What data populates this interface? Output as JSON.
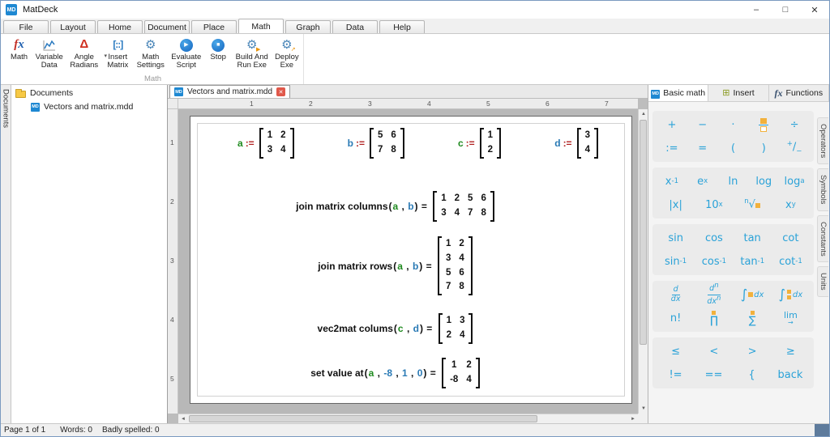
{
  "window": {
    "logo": "MD",
    "title": "MatDeck",
    "controls": [
      {
        "name": "minimize",
        "glyph": "–"
      },
      {
        "name": "maximize",
        "glyph": "□"
      },
      {
        "name": "close",
        "glyph": "✕"
      }
    ]
  },
  "menu_tabs": [
    {
      "label": "File"
    },
    {
      "label": "Layout"
    },
    {
      "label": "Home"
    },
    {
      "label": "Document"
    },
    {
      "label": "Place"
    },
    {
      "label": "Math",
      "active": true
    },
    {
      "label": "Graph"
    },
    {
      "label": "Data"
    },
    {
      "label": "Help"
    }
  ],
  "ribbon": {
    "group_label": "Math",
    "buttons": [
      {
        "label": "Math",
        "icon": "fx"
      },
      {
        "label": "Variable Data",
        "icon": "chart"
      },
      {
        "label": "Angle Radians",
        "icon": "delta",
        "dropdown": true
      },
      {
        "label": "Insert Matrix",
        "icon": "matrix"
      },
      {
        "label": "Math Settings",
        "icon": "gear"
      },
      {
        "label": "Evaluate Script",
        "icon": "play"
      },
      {
        "label": "Stop",
        "icon": "stop"
      },
      {
        "label": "Build And Run Exe",
        "icon": "gear-run"
      },
      {
        "label": "Deploy Exe",
        "icon": "gear-deploy"
      }
    ]
  },
  "left_tab": {
    "label": "Documents"
  },
  "documents_panel": {
    "root_label": "Documents",
    "items": [
      {
        "label": "Vectors and matrix.mdd"
      }
    ]
  },
  "document_tabs": [
    {
      "label": "Vectors and matrix.mdd",
      "active": true
    }
  ],
  "rulers": {
    "horizontal": [
      "1",
      "2",
      "3",
      "4",
      "5",
      "6",
      "7"
    ],
    "vertical": [
      "1",
      "2",
      "3",
      "4",
      "5"
    ]
  },
  "scrollbars": {
    "up": "▲",
    "down": "▼",
    "left": "◄",
    "right": "►"
  },
  "document": {
    "assign_symbol": ":=",
    "syntax": {
      "open": "(",
      "close": ")",
      "comma": " , ",
      "equals": " = "
    },
    "definitions": [
      {
        "name": "a",
        "color": "g",
        "rows": [
          [
            "1",
            "2"
          ],
          [
            "3",
            "4"
          ]
        ]
      },
      {
        "name": "b",
        "color": "b",
        "rows": [
          [
            "5",
            "6"
          ],
          [
            "7",
            "8"
          ]
        ]
      },
      {
        "name": "c",
        "color": "g",
        "rows": [
          [
            "1"
          ],
          [
            "2"
          ]
        ]
      },
      {
        "name": "d",
        "color": "b",
        "rows": [
          [
            "3"
          ],
          [
            "4"
          ]
        ]
      }
    ],
    "expressions": [
      {
        "func": "join matrix columns",
        "args": [
          {
            "t": "a",
            "c": "g"
          },
          {
            "t": "b",
            "c": "b"
          }
        ],
        "result": [
          [
            "1",
            "2",
            "5",
            "6"
          ],
          [
            "3",
            "4",
            "7",
            "8"
          ]
        ]
      },
      {
        "func": "join matrix rows",
        "args": [
          {
            "t": "a",
            "c": "g"
          },
          {
            "t": "b",
            "c": "b"
          }
        ],
        "result": [
          [
            "1",
            "2"
          ],
          [
            "3",
            "4"
          ],
          [
            "5",
            "6"
          ],
          [
            "7",
            "8"
          ]
        ]
      },
      {
        "func": "vec2mat colums",
        "args": [
          {
            "t": "c",
            "c": "g"
          },
          {
            "t": "d",
            "c": "b"
          }
        ],
        "result": [
          [
            "1",
            "3"
          ],
          [
            "2",
            "4"
          ]
        ]
      },
      {
        "func": "set value at",
        "args": [
          {
            "t": "a",
            "c": "g"
          },
          {
            "t": "-8",
            "c": "b"
          },
          {
            "t": "1",
            "c": "b"
          },
          {
            "t": "0",
            "c": "b"
          }
        ],
        "result": [
          [
            "1",
            "2"
          ],
          [
            "-8",
            "4"
          ]
        ]
      }
    ]
  },
  "right_panel": {
    "tabs": [
      {
        "label": "Basic math",
        "icon": "md",
        "active": true
      },
      {
        "label": "Insert",
        "icon": "insert"
      },
      {
        "label": "Functions",
        "icon": "fx"
      }
    ],
    "side_tabs": [
      "Operators",
      "Symbols",
      "Constants",
      "Units"
    ],
    "accent_color": "#2aa2d8",
    "placeholder_color": "#f2b13c",
    "groups": [
      {
        "rows": [
          [
            {
              "name": "plus",
              "l": "+"
            },
            {
              "name": "minus",
              "l": "−"
            },
            {
              "name": "multiply-dot",
              "l": "·"
            },
            {
              "name": "fraction",
              "ic": "frac"
            },
            {
              "name": "divide",
              "l": "÷"
            }
          ],
          [
            {
              "name": "assign",
              "l": ":="
            },
            {
              "name": "equals",
              "l": "="
            },
            {
              "name": "paren-open",
              "l": "("
            },
            {
              "name": "paren-close",
              "l": ")"
            },
            {
              "name": "plus-minus",
              "ic": "pm"
            }
          ]
        ]
      },
      {
        "rows": [
          [
            {
              "name": "x-inverse",
              "b": "x",
              "sup": "-1"
            },
            {
              "name": "e-power-x",
              "b": "e",
              "sup": "x"
            },
            {
              "name": "natural-log",
              "l": "ln"
            },
            {
              "name": "log",
              "l": "log"
            },
            {
              "name": "log-base-a",
              "b": "log",
              "sub": "a"
            }
          ],
          [
            {
              "name": "absolute-value",
              "l": "|x|"
            },
            {
              "name": "ten-power-x",
              "b": "10",
              "sup": "x"
            },
            {
              "name": "nth-root",
              "ic": "nroot"
            },
            {
              "name": "x-power-y",
              "b": "x",
              "sup": "y"
            }
          ]
        ]
      },
      {
        "rows": [
          [
            {
              "name": "sin",
              "l": "sin"
            },
            {
              "name": "cos",
              "l": "cos"
            },
            {
              "name": "tan",
              "l": "tan"
            },
            {
              "name": "cot",
              "l": "cot"
            }
          ],
          [
            {
              "name": "arcsin",
              "b": "sin",
              "sup": "-1"
            },
            {
              "name": "arccos",
              "b": "cos",
              "sup": "-1"
            },
            {
              "name": "arctan",
              "b": "tan",
              "sup": "-1"
            },
            {
              "name": "arccot",
              "b": "cot",
              "sup": "-1"
            }
          ]
        ]
      },
      {
        "rows": [
          [
            {
              "name": "derivative",
              "ic": "ddx"
            },
            {
              "name": "nth-derivative",
              "ic": "dndxn"
            },
            {
              "name": "integral",
              "ic": "intdx"
            },
            {
              "name": "definite-integral",
              "ic": "intlim"
            }
          ],
          [
            {
              "name": "factorial",
              "l": "n!"
            },
            {
              "name": "product",
              "ic": "prod"
            },
            {
              "name": "sum",
              "ic": "sum"
            },
            {
              "name": "limit",
              "ic": "lim"
            }
          ]
        ]
      },
      {
        "rows": [
          [
            {
              "name": "less-equal",
              "l": "≤"
            },
            {
              "name": "less-than",
              "l": "<"
            },
            {
              "name": "greater-than",
              "l": ">"
            },
            {
              "name": "greater-equal",
              "l": "≥"
            }
          ],
          [
            {
              "name": "not-equal",
              "l": "!="
            },
            {
              "name": "equal-equal",
              "l": "=="
            },
            {
              "name": "brace",
              "l": "{"
            },
            {
              "name": "back",
              "l": "back"
            }
          ]
        ]
      }
    ]
  },
  "status_bar": {
    "page": "Page 1 of 1",
    "words": "Words: 0",
    "spelling": "Badly spelled: 0"
  }
}
